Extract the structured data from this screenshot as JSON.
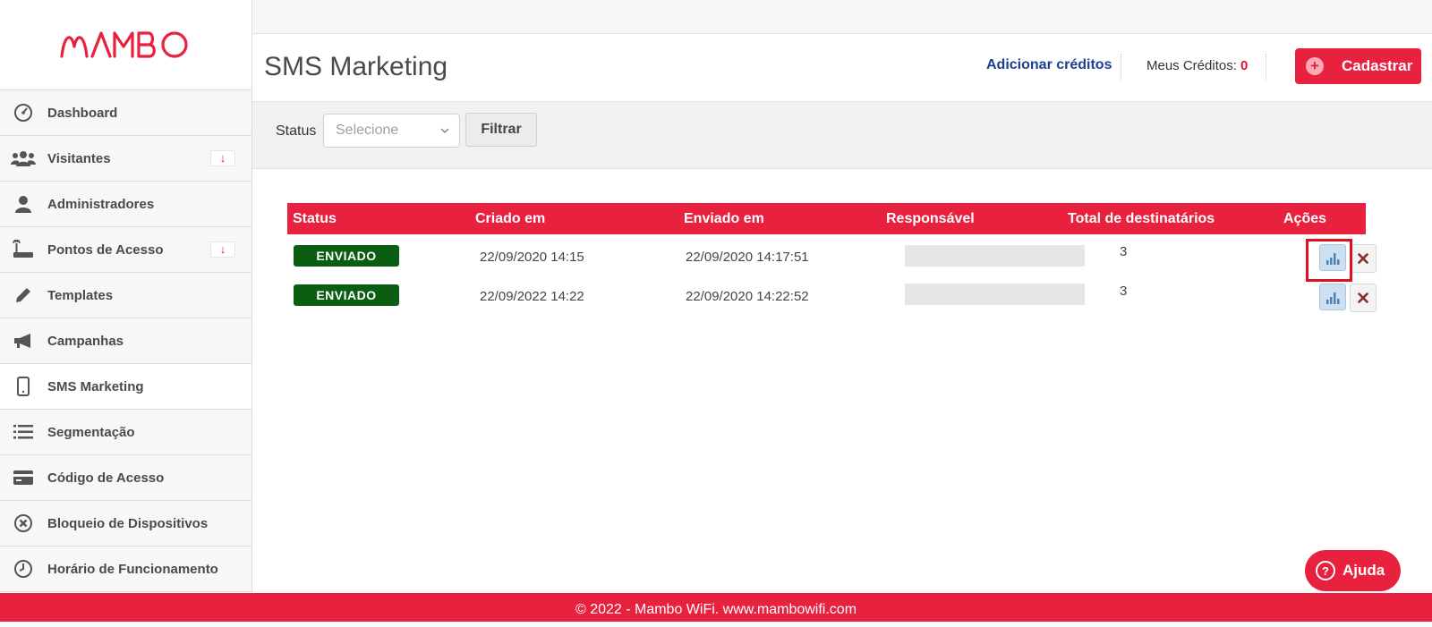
{
  "brand": {
    "logo_text": "MAMBO",
    "color": "#e8213f"
  },
  "sidebar": {
    "items": [
      {
        "label": "Dashboard",
        "icon": "dashboard-gauge-icon"
      },
      {
        "label": "Visitantes",
        "icon": "users-icon",
        "badge": "↓"
      },
      {
        "label": "Administradores",
        "icon": "user-icon"
      },
      {
        "label": "Pontos de Acesso",
        "icon": "router-icon",
        "badge": "↓"
      },
      {
        "label": "Templates",
        "icon": "pencil-icon"
      },
      {
        "label": "Campanhas",
        "icon": "megaphone-icon"
      },
      {
        "label": "SMS Marketing",
        "icon": "phone-icon",
        "active": true
      },
      {
        "label": "Segmentação",
        "icon": "list-icon"
      },
      {
        "label": "Código de Acesso",
        "icon": "card-icon"
      },
      {
        "label": "Bloqueio de Dispositivos",
        "icon": "block-icon"
      },
      {
        "label": "Horário de Funcionamento",
        "icon": "clock-icon"
      }
    ]
  },
  "header": {
    "title": "SMS Marketing",
    "add_credits": "Adicionar créditos",
    "credits_label": "Meus Créditos:",
    "credits_value": "0",
    "register_button": "Cadastrar"
  },
  "filter": {
    "status_label": "Status",
    "select_placeholder": "Selecione",
    "filter_button": "Filtrar"
  },
  "table": {
    "columns": [
      "Status",
      "Criado em",
      "Enviado em",
      "Responsável",
      "Total de destinatários",
      "Ações"
    ],
    "rows": [
      {
        "status": "ENVIADO",
        "created": "22/09/2020 14:15",
        "sent": "22/09/2020 14:17:51",
        "total": "3"
      },
      {
        "status": "ENVIADO",
        "created": "22/09/2022 14:22",
        "sent": "22/09/2020 14:22:52",
        "total": "3"
      }
    ]
  },
  "help_button": "Ajuda",
  "footer": "© 2022 - Mambo WiFi. www.mambowifi.com"
}
